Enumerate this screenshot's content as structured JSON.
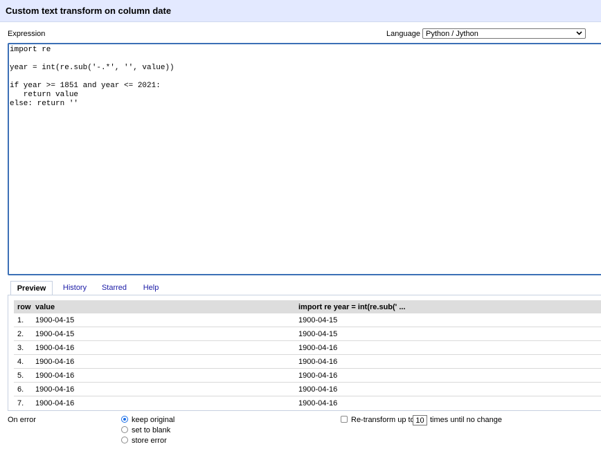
{
  "dialog": {
    "title": "Custom text transform on column date"
  },
  "expression": {
    "label": "Expression",
    "language_label": "Language",
    "language_value": "Python / Jython",
    "code": "import re\n\nyear = int(re.sub('-.*', '', value))\n\nif year >= 1851 and year <= 2021:\n   return value\nelse: return ''"
  },
  "tabs": [
    {
      "label": "Preview",
      "active": true
    },
    {
      "label": "History",
      "active": false
    },
    {
      "label": "Starred",
      "active": false
    },
    {
      "label": "Help",
      "active": false
    }
  ],
  "preview": {
    "columns": [
      "row",
      "value",
      "import re year = int(re.sub(' ..."
    ],
    "rows": [
      {
        "row": "1.",
        "value": "1900-04-15",
        "result": "1900-04-15"
      },
      {
        "row": "2.",
        "value": "1900-04-15",
        "result": "1900-04-15"
      },
      {
        "row": "3.",
        "value": "1900-04-16",
        "result": "1900-04-16"
      },
      {
        "row": "4.",
        "value": "1900-04-16",
        "result": "1900-04-16"
      },
      {
        "row": "5.",
        "value": "1900-04-16",
        "result": "1900-04-16"
      },
      {
        "row": "6.",
        "value": "1900-04-16",
        "result": "1900-04-16"
      },
      {
        "row": "7.",
        "value": "1900-04-16",
        "result": "1900-04-16"
      }
    ]
  },
  "on_error": {
    "label": "On error",
    "options": [
      {
        "label": "keep original",
        "checked": true
      },
      {
        "label": "set to blank",
        "checked": false
      },
      {
        "label": "store error",
        "checked": false
      }
    ]
  },
  "retransform": {
    "checked": false,
    "label_before": "Re-transform up to",
    "times_value": "10",
    "label_after": "times until no change"
  },
  "colors": {
    "accent": "#3b6fb6",
    "titlebar": "#e3e9ff",
    "link": "#1a1aa6",
    "header_row": "#dddddd"
  }
}
